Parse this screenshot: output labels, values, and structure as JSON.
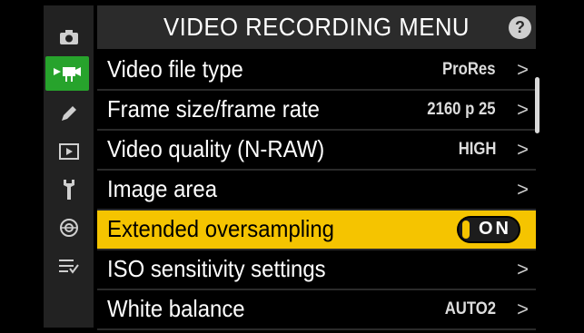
{
  "title": "VIDEO RECORDING MENU",
  "help_label": "?",
  "sidebar": {
    "items": [
      {
        "icon": "camera-icon"
      },
      {
        "icon": "video-icon",
        "active": true
      },
      {
        "icon": "pencil-icon"
      },
      {
        "icon": "playback-icon"
      },
      {
        "icon": "wrench-icon"
      },
      {
        "icon": "network-icon"
      },
      {
        "icon": "my-menu-icon"
      }
    ]
  },
  "rows": [
    {
      "label": "Video file type",
      "value": "ProRes"
    },
    {
      "label": "Frame size/frame rate",
      "value": "2160 p 25"
    },
    {
      "label": "Video quality (N-RAW)",
      "value": "HIGH"
    },
    {
      "label": "Image area",
      "value": ""
    },
    {
      "label": "Extended oversampling",
      "value": "ON"
    },
    {
      "label": "ISO sensitivity settings",
      "value": ""
    },
    {
      "label": "White balance",
      "value": "AUTO2"
    }
  ],
  "chevron": ">",
  "colors": {
    "accent": "#f5c400",
    "active_tab": "#27a32c",
    "sidebar": "#222222"
  }
}
